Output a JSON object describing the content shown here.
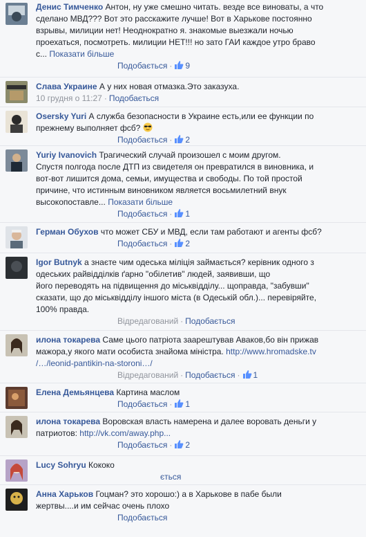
{
  "separator": "·",
  "comments": [
    {
      "author": "Денис Тимченко",
      "text_lines": [
        "Антон, ну уже смешно читать. везде все виноваты, а что",
        "сделано МВД??? Вот это расскажите лучше! Вот в Харькове постоянно",
        "взрывы, милиции нет! Неоднократно я. знакомые выезжали ночью",
        "проехаться, посмотреть. милиции НЕТ!!! но зато ГАИ каждое утро браво",
        "с..."
      ],
      "more": "Показати більше",
      "like": "Подобається",
      "likes": "9"
    },
    {
      "author": "Слава Украине",
      "text_lines": [
        "А у них новая отмазка.Это заказуха."
      ],
      "date": "10 грудня о 11:27",
      "like": "Подобається"
    },
    {
      "author": "Osersky Yuri",
      "text_lines": [
        "А служба безопасности в Украине есть,или ее функции по",
        "прежнему выполняет фсб?"
      ],
      "like": "Подобається",
      "likes": "2"
    },
    {
      "author": "Yuriy Ivanovich",
      "text_lines": [
        "Трагический случай произошел с моим другом.",
        "Спустя полгода после ДТП из свидетеля он превратился в виновника, и",
        "вот-вот лишится дома, семьи, имущества и свободы. По той простой",
        "причине, что истинным виновником является восьмилетний внук",
        "высокопоставле..."
      ],
      "more": "Показати більше",
      "like": "Подобається",
      "likes": "1"
    },
    {
      "author": "Герман Обухов",
      "text_lines": [
        "что может СБУ и МВД, если там работают и агенты фсб?"
      ],
      "like": "Подобається",
      "likes": "2"
    },
    {
      "author": "Igor Butnyk",
      "text_lines": [
        "а знаєте чим одеська міліція займається? керівник одного з",
        "одеських райвідділків ґарно \"обілетив\" людей, заявивши, що",
        "його переводять на підвищення до міськвідділу... щоправда, \"забувши\"",
        "сказати, що до міськвідділу іншого міста (в Одеській обл.)... перевіряйте,",
        "100% правда."
      ],
      "edited": "Відредагований",
      "like": "Подобається"
    },
    {
      "author": "илона токарева",
      "text_lines": [
        "Саме цього патріота заарештував Аваков,бо він прижав",
        "мажора,у якого мати особиста знайома міністра."
      ],
      "link_inline": "http://www.hromadske.tv",
      "link_line": "/…/leonid-pantikin-na-storoni…/",
      "edited": "Відредагований",
      "like": "Подобається",
      "likes": "1"
    },
    {
      "author": "Елена Демьянцева",
      "text_lines": [
        "Картина маслом"
      ],
      "like": "Подобається",
      "likes": "1"
    },
    {
      "author": "илона токарева",
      "text_lines": [
        "Воровская власть намерена и далее воровать деньги у",
        "патриотов:"
      ],
      "link_inline": "http://vk.com/away.php...",
      "like": "Подобається",
      "likes": "2"
    },
    {
      "author": "Lucy Sohryu",
      "text_lines": [
        "Кококо"
      ],
      "like_partial": "ється"
    },
    {
      "author": "Анна Харьков",
      "text_lines": [
        "Гоцман? это хорошо:) а в Харькове в пабе были",
        "жертвы....и им сейчас очень плохо"
      ],
      "like": "Подобається"
    }
  ]
}
